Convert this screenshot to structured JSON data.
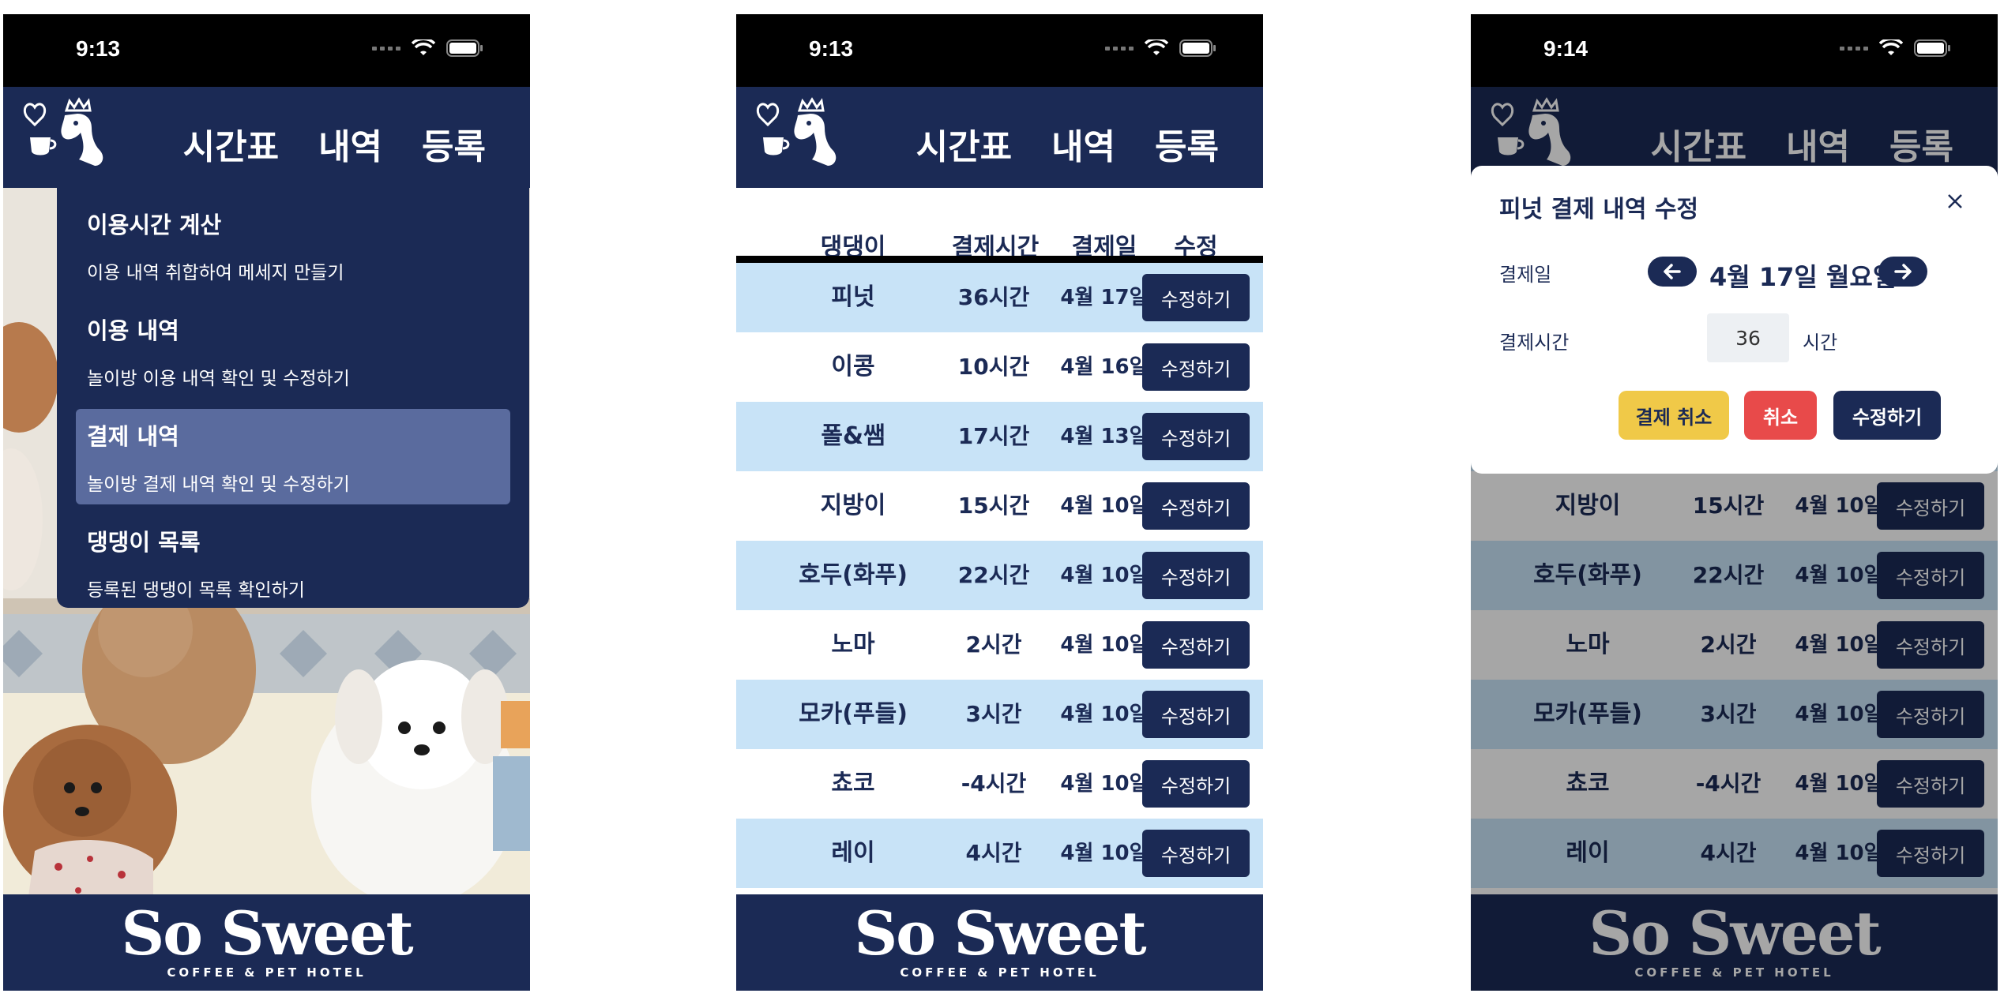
{
  "colors": {
    "navy": "#1b2a55",
    "row_alt": "#c8e3f7",
    "active_menu": "#5a6b9e",
    "cancel_payment": "#f0c948",
    "cancel": "#e84a4a"
  },
  "status": {
    "time_1": "9:13",
    "time_2": "9:13",
    "time_3": "9:14"
  },
  "nav": {
    "logo": "dog-with-crown-logo",
    "items": [
      "시간표",
      "내역",
      "등록"
    ]
  },
  "dropdown": {
    "items": [
      {
        "title": "이용시간 계산",
        "desc": "이용 내역 취합하여 메세지 만들기"
      },
      {
        "title": "이용 내역",
        "desc": "놀이방 이용 내역 확인 및 수정하기"
      },
      {
        "title": "결제 내역",
        "desc": "놀이방 결제 내역 확인 및 수정하기"
      },
      {
        "title": "댕댕이 목록",
        "desc": "등록된 댕댕이 목록 확인하기"
      }
    ]
  },
  "table": {
    "headers": {
      "name": "댕댕이",
      "time": "결제시간",
      "date": "결제일",
      "edit": "수정"
    },
    "edit_label": "수정하기",
    "rows": [
      {
        "name": "피넛",
        "time": "36시간",
        "date": "4월 17일"
      },
      {
        "name": "이콩",
        "time": "10시간",
        "date": "4월 16일"
      },
      {
        "name": "폴&쌤",
        "time": "17시간",
        "date": "4월 13일"
      },
      {
        "name": "지방이",
        "time": "15시간",
        "date": "4월 10일"
      },
      {
        "name": "호두(화푸)",
        "time": "22시간",
        "date": "4월 10일"
      },
      {
        "name": "노마",
        "time": "2시간",
        "date": "4월 10일"
      },
      {
        "name": "모카(푸들)",
        "time": "3시간",
        "date": "4월 10일"
      },
      {
        "name": "쵸코",
        "time": "-4시간",
        "date": "4월 10일"
      },
      {
        "name": "레이",
        "time": "4시간",
        "date": "4월 10일"
      }
    ]
  },
  "modal": {
    "title": "피넛 결제 내역 수정",
    "date_label": "결제일",
    "date_value": "4월 17일 월요일",
    "hours_label": "결제시간",
    "hours_value": "36",
    "hours_unit": "시간",
    "cancel_payment": "결제 취소",
    "cancel": "취소",
    "submit": "수정하기"
  },
  "footer": {
    "brand": "So Sweet",
    "sub": "COFFEE & PET HOTEL"
  }
}
